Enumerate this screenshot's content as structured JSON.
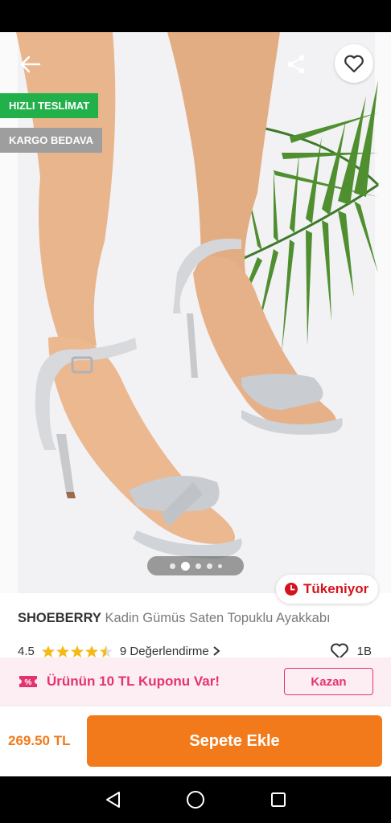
{
  "badges": {
    "fast_delivery": "HIZLI TESLİMAT",
    "free_cargo": "KARGO BEDAVA"
  },
  "icons": {
    "back": "arrow-left-icon",
    "share": "share-icon",
    "favorite": "heart-outline-icon",
    "stock": "clock-icon",
    "coupon": "coupon-ticket-icon",
    "likes": "heart-outline-icon"
  },
  "gallery": {
    "current_index": 2,
    "total": 5
  },
  "stock_label": "Tükeniyor",
  "product": {
    "brand": "SHOEBERRY",
    "name": "Kadin Gümüs Saten Topuklu Ayakkabı",
    "rating": "4.5",
    "rating_value": 4.5,
    "review_link": "9 Değerlendirme",
    "likes": "1B"
  },
  "coupon": {
    "text": "Ürünün 10 TL Kuponu Var!",
    "button": "Kazan"
  },
  "purchase": {
    "price": "269.50 TL",
    "cart_button": "Sepete Ekle"
  },
  "colors": {
    "brand_orange": "#f27a1a",
    "coupon_pink": "#e5336f",
    "stock_red": "#d5131d",
    "star": "#f7b916",
    "fast_green": "#22b04b"
  }
}
